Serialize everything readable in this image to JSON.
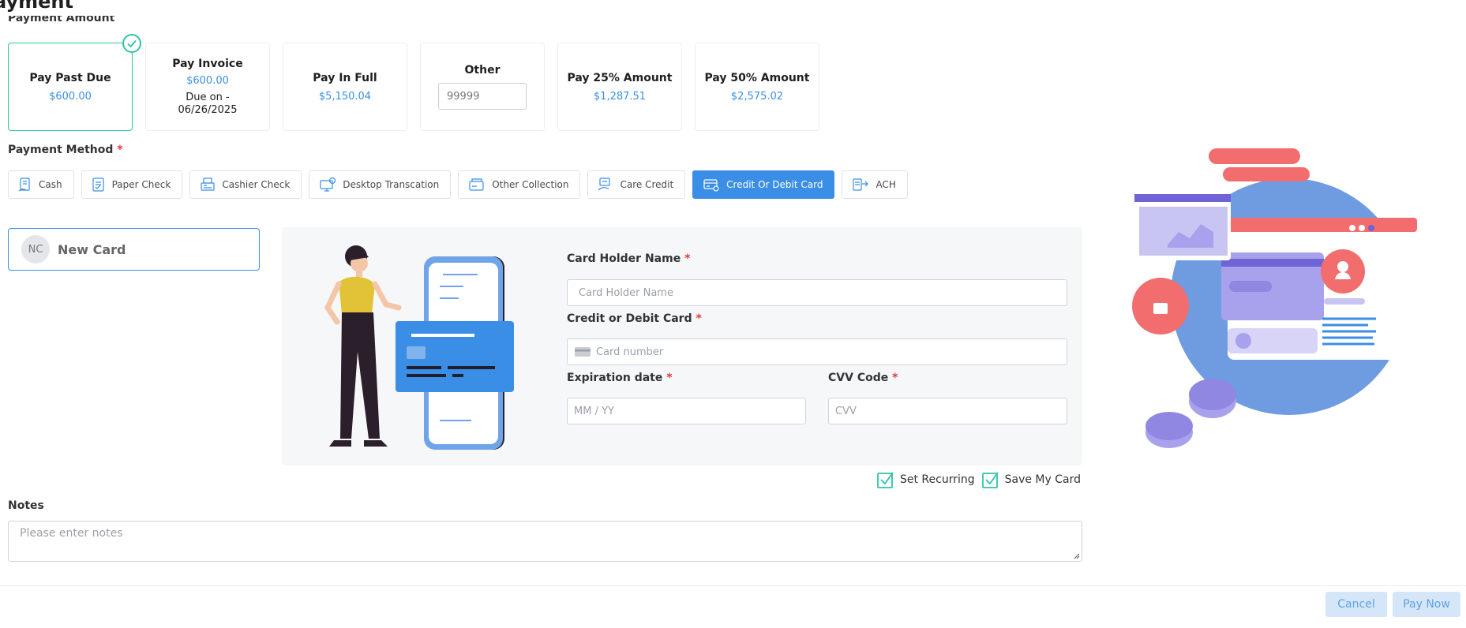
{
  "page": {
    "title": "ayment",
    "amount_section_label": "Payment Amount"
  },
  "amounts": [
    {
      "title": "Pay Past Due",
      "value": "$600.00"
    },
    {
      "title": "Pay Invoice",
      "value": "$600.00",
      "due": "Due on - 06/26/2025"
    },
    {
      "title": "Pay In Full",
      "value": "$5,150.04"
    },
    {
      "title": "Other",
      "placeholder": "99999"
    },
    {
      "title": "Pay 25% Amount",
      "value": "$1,287.51"
    },
    {
      "title": "Pay 50% Amount",
      "value": "$2,575.02"
    }
  ],
  "payment_method": {
    "label": "Payment Method",
    "required_mark": "*",
    "options": [
      "Cash",
      "Paper Check",
      "Cashier Check",
      "Desktop Transcation",
      "Other Collection",
      "Care Credit",
      "Credit Or Debit Card",
      "ACH"
    ],
    "selected": "Credit Or Debit Card"
  },
  "new_card": {
    "initials": "NC",
    "label": "New Card"
  },
  "card_form": {
    "holder_label": "Card Holder Name",
    "holder_placeholder": "Card Holder Name",
    "card_label": "Credit or Debit Card",
    "card_placeholder": "Card number",
    "exp_label": "Expiration date",
    "exp_placeholder": "MM / YY",
    "cvv_label": "CVV Code",
    "cvv_placeholder": "CVV",
    "required_mark": "*"
  },
  "options": {
    "recurring": "Set Recurring",
    "save_card": "Save My Card"
  },
  "notes": {
    "label": "Notes",
    "placeholder": "Please enter notes"
  },
  "actions": {
    "cancel": "Cancel",
    "pay_now": "Pay Now"
  },
  "colors": {
    "accent": "#3a8ee6",
    "success": "#2ec4a6",
    "required": "#e53935",
    "illustration_blue": "#6f9be0",
    "illustration_red": "#f26d6d"
  }
}
